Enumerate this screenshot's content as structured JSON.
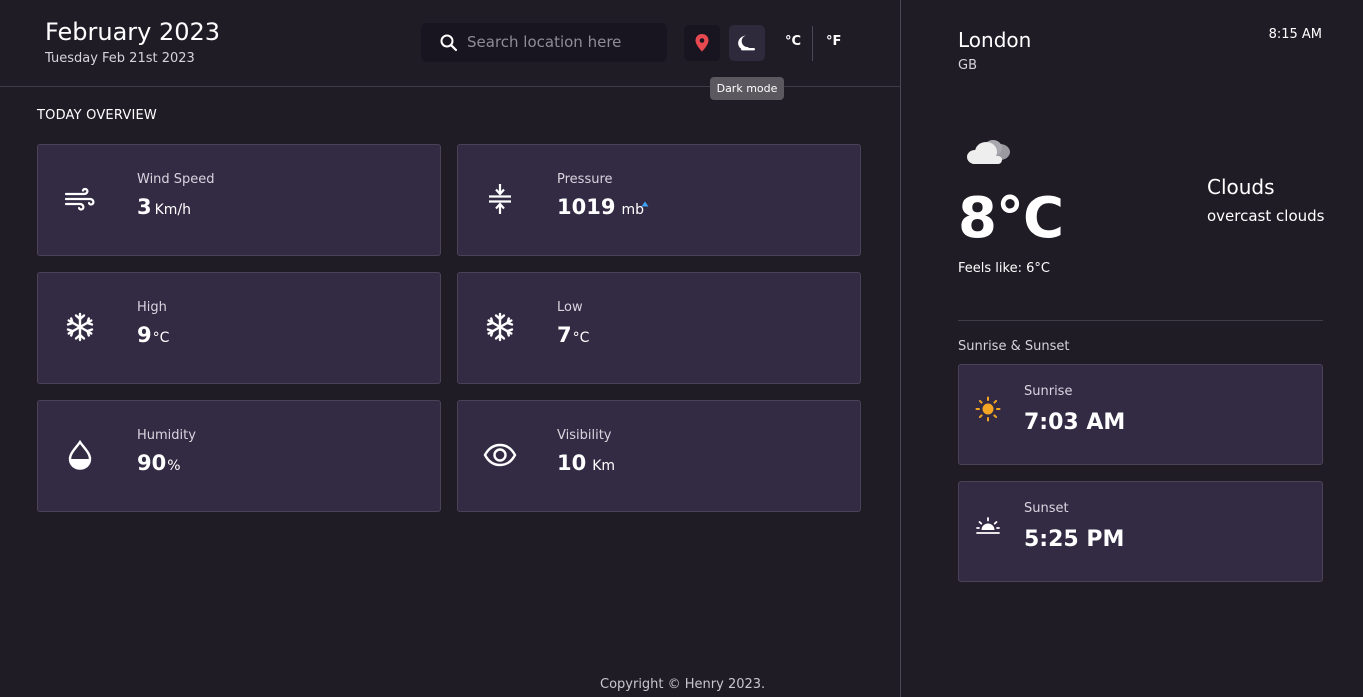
{
  "header": {
    "month_title": "February 2023",
    "date_sub": "Tuesday Feb 21st 2023",
    "search": {
      "placeholder": "Search location here",
      "icon": "search-icon"
    },
    "location_button_icon": "map-pin-icon",
    "dark_mode_button_icon": "moon-icon",
    "unit_celsius": "°C",
    "unit_fahrenheit": "°F",
    "tooltip": "Dark mode"
  },
  "overview": {
    "title": "TODAY OVERVIEW",
    "cards": [
      {
        "label": "Wind Speed",
        "value": "3",
        "unit": "Km/h",
        "icon": "wind-icon"
      },
      {
        "label": "Pressure",
        "value": "1019",
        "unit": "mb",
        "icon": "pressure-icon"
      },
      {
        "label": "High",
        "value": "9",
        "unit": "°C",
        "icon": "snowflake-icon"
      },
      {
        "label": "Low",
        "value": "7",
        "unit": "°C",
        "icon": "snowflake-icon"
      },
      {
        "label": "Humidity",
        "value": "90",
        "unit": "%",
        "icon": "droplet-icon"
      },
      {
        "label": "Visibility",
        "value": "10",
        "unit": "Km",
        "icon": "eye-icon"
      }
    ]
  },
  "footer": {
    "copyright": "Copyright © Henry 2023."
  },
  "side": {
    "city": "London",
    "country": "GB",
    "time": "8:15 AM",
    "weather_icon": "cloud-icon",
    "temperature": "8°C",
    "feels_like": "Feels like: 6°C",
    "condition": "Clouds",
    "condition_desc": "overcast clouds",
    "sun_title": "Sunrise & Sunset",
    "sunrise": {
      "label": "Sunrise",
      "time": "7:03 AM",
      "icon": "sun-icon"
    },
    "sunset": {
      "label": "Sunset",
      "time": "5:25 PM",
      "icon": "sunset-icon"
    }
  },
  "colors": {
    "background": "#1f1c26",
    "card": "#332b44",
    "accent_red": "#e8484f",
    "accent_sun": "#f5a524",
    "pressure_dot": "#3da4f5"
  }
}
